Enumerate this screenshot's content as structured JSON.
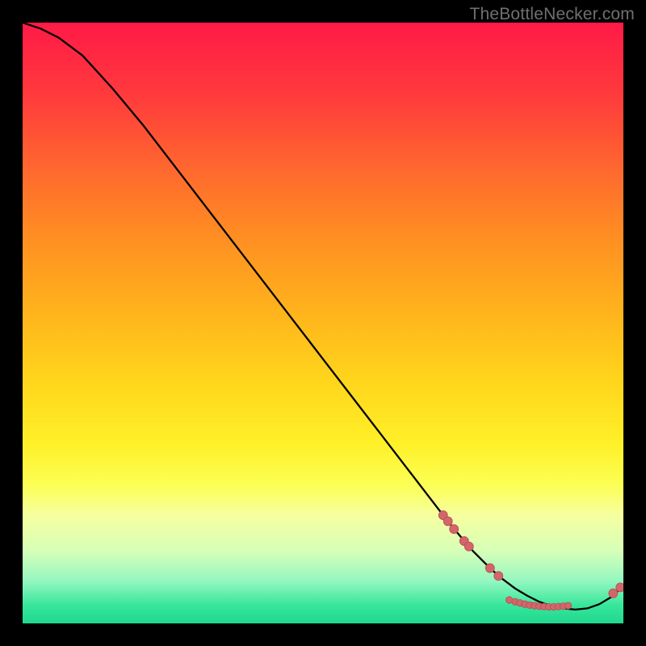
{
  "watermark": "TheBottleNecker.com",
  "colors": {
    "gradient_top": "#ff1a47",
    "gradient_mid": "#ffd61c",
    "gradient_bottom": "#1fd88f",
    "curve": "#000000",
    "marker_fill": "#d4656b",
    "marker_stroke": "#b04f55",
    "background": "#000000"
  },
  "chart_data": {
    "type": "line",
    "title": "",
    "xlabel": "",
    "ylabel": "",
    "xlim": [
      0,
      100
    ],
    "ylim": [
      0,
      100
    ],
    "curve": {
      "x": [
        0,
        3,
        6,
        10,
        15,
        20,
        25,
        30,
        35,
        40,
        45,
        50,
        55,
        60,
        65,
        70,
        72,
        75,
        78,
        80,
        82,
        84,
        86,
        88,
        90,
        92,
        94,
        96,
        98,
        100
      ],
      "y": [
        100,
        99,
        97.5,
        94.5,
        89,
        83,
        76.5,
        70,
        63.5,
        57,
        50.5,
        44,
        37.5,
        31,
        24.5,
        18,
        15.5,
        12,
        9,
        7.3,
        5.8,
        4.6,
        3.6,
        2.9,
        2.5,
        2.3,
        2.5,
        3.2,
        4.4,
        6.2
      ]
    },
    "markers_cluster_a": [
      {
        "x": 70.0,
        "y": 18.0
      },
      {
        "x": 70.8,
        "y": 17.0
      },
      {
        "x": 71.8,
        "y": 15.7
      },
      {
        "x": 73.5,
        "y": 13.7
      },
      {
        "x": 74.3,
        "y": 12.8
      },
      {
        "x": 77.8,
        "y": 9.2
      },
      {
        "x": 79.2,
        "y": 7.9
      }
    ],
    "markers_cluster_b": [
      {
        "x": 81.0,
        "y": 3.9
      },
      {
        "x": 82.0,
        "y": 3.6
      },
      {
        "x": 82.8,
        "y": 3.4
      },
      {
        "x": 83.6,
        "y": 3.2
      },
      {
        "x": 84.4,
        "y": 3.05
      },
      {
        "x": 85.2,
        "y": 2.95
      },
      {
        "x": 86.0,
        "y": 2.85
      },
      {
        "x": 86.8,
        "y": 2.8
      },
      {
        "x": 87.6,
        "y": 2.75
      },
      {
        "x": 88.4,
        "y": 2.75
      },
      {
        "x": 89.2,
        "y": 2.8
      },
      {
        "x": 90.0,
        "y": 2.85
      },
      {
        "x": 90.8,
        "y": 2.95
      }
    ],
    "markers_cluster_c": [
      {
        "x": 98.3,
        "y": 5.0
      },
      {
        "x": 99.5,
        "y": 6.0
      }
    ]
  }
}
